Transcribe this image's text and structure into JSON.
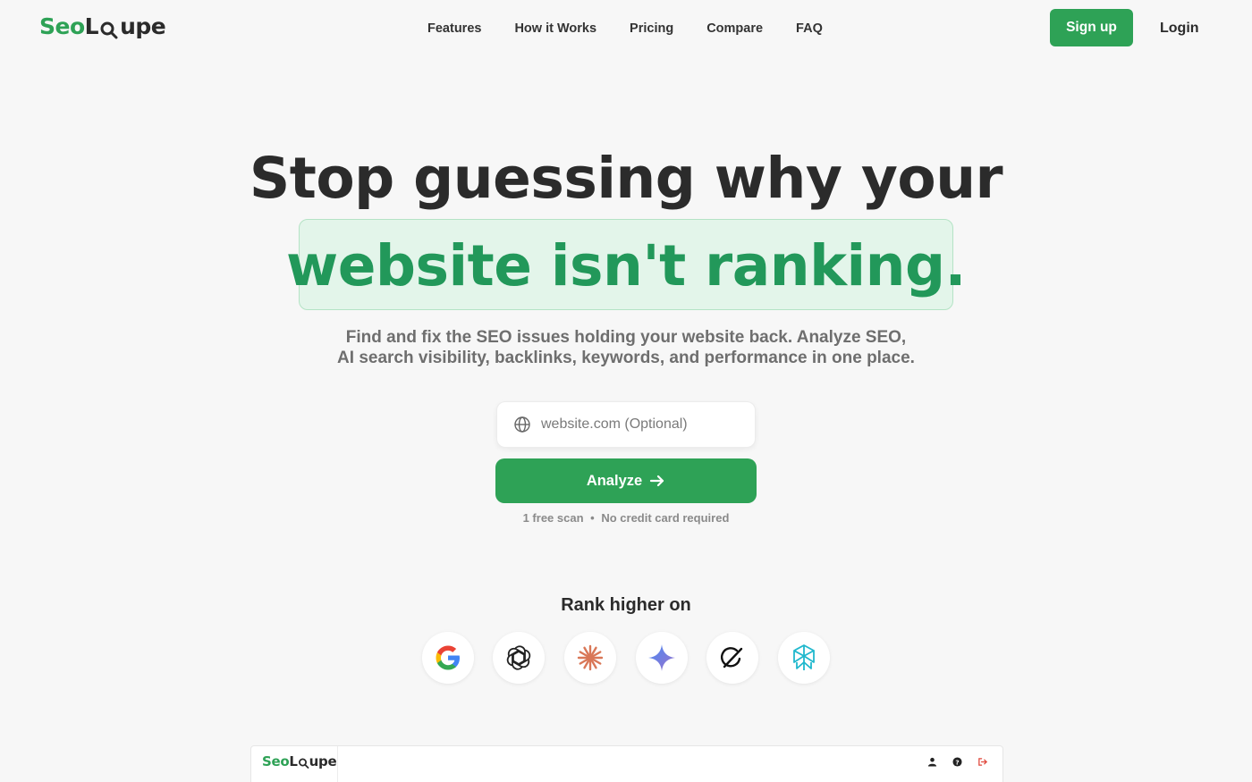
{
  "brand": {
    "prefix": "Seo",
    "l": "L",
    "suffix": "upe",
    "accent": "#2ea256"
  },
  "nav": {
    "items": [
      "Features",
      "How it Works",
      "Pricing",
      "Compare",
      "FAQ"
    ]
  },
  "auth": {
    "signup": "Sign up",
    "login": "Login"
  },
  "hero": {
    "headline_line1": "Stop guessing why your",
    "headline_line2": "website isn't ranking.",
    "subtitle_line1": "Find and fix the SEO issues holding your website back. Analyze SEO,",
    "subtitle_line2": "AI search visibility, backlinks, keywords, and performance in one place."
  },
  "search": {
    "placeholder": "website.com (Optional)",
    "icon": "globe-icon"
  },
  "cta": {
    "analyze": "Analyze",
    "icon": "arrow-right-icon"
  },
  "note": {
    "left": "1 free scan",
    "separator": "•",
    "right": "No credit card required"
  },
  "rank": {
    "title": "Rank higher on",
    "engines": [
      "google-icon",
      "chatgpt-icon",
      "claude-icon",
      "gemini-icon",
      "grok-icon",
      "perplexity-icon"
    ]
  },
  "preview": {
    "icons": [
      "user-icon",
      "help-icon",
      "logout-icon"
    ]
  }
}
